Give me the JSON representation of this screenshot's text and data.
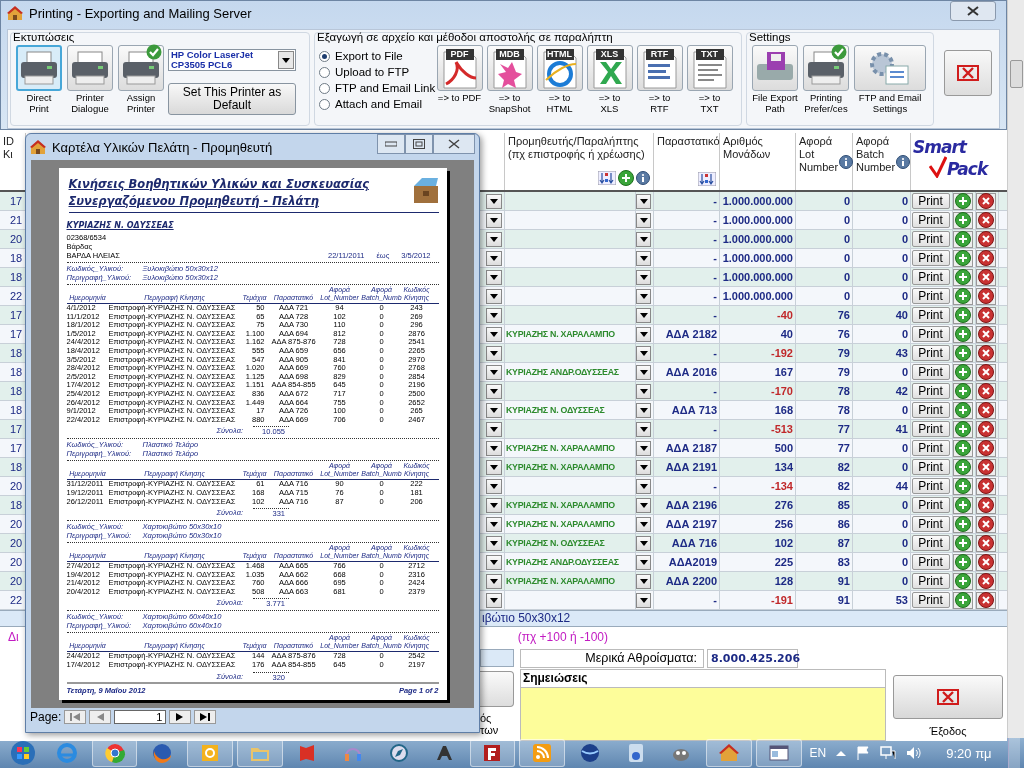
{
  "print_dialog": {
    "title": "Printing - Exporting and Mailing Server",
    "printing": {
      "title": "Εκτυπώσεις",
      "buttons": [
        {
          "label": "Direct\nPrint",
          "selected": true,
          "check": false
        },
        {
          "label": "Printer\nDialogue",
          "selected": false,
          "check": false
        },
        {
          "label": "Assign\nPrinter",
          "selected": false,
          "check": true
        }
      ],
      "printer": "HP Color LaserJet CP3505 PCL6",
      "set_default": "Set This Printer as Default"
    },
    "export": {
      "title": "Εξαγωγή σε αρχείο και μέθοδοι αποστολής σε παραλήπτη",
      "methods": [
        {
          "label": "Export to File",
          "selected": true
        },
        {
          "label": "Upload to FTP",
          "selected": false
        },
        {
          "label": "FTP and Email Link",
          "selected": false
        },
        {
          "label": "Attach and Email",
          "selected": false
        }
      ],
      "formats": [
        {
          "kind": "pdf",
          "icon_text": "PDF",
          "label": "=> to PDF"
        },
        {
          "kind": "mdb",
          "icon_text": "MDB",
          "label": "=> to\nSnapShot"
        },
        {
          "kind": "html",
          "icon_text": "HTML",
          "label": "=> to\nHTML"
        },
        {
          "kind": "xls",
          "icon_text": "XLS",
          "label": "=> to\nXLS"
        },
        {
          "kind": "rtf",
          "icon_text": "RTF",
          "label": "=> to\nRTF"
        },
        {
          "kind": "txt",
          "icon_text": "TXT",
          "label": "=> to\nTXT"
        }
      ]
    },
    "settings": {
      "title": "Settings",
      "buttons": [
        {
          "kind": "disk",
          "label": "File Export\nPath",
          "check": false
        },
        {
          "kind": "printer",
          "label": "Printing\nPrefer/ces",
          "check": true
        },
        {
          "kind": "gear",
          "label": "FTP and Email\nSettings",
          "check": false
        }
      ]
    }
  },
  "table": {
    "id_header": "ID\nΚι",
    "columns": [
      "Προμηθευτής/Παραλήπτης\n(πχ επιστροφής ή χρέωσης)",
      "Παραστατικό",
      "Αριθμός\nΜονάδων",
      "Αφορά\nLot\nNumber",
      "Αφορά\nBatch\nNumber"
    ],
    "logo": {
      "line_1": "Smart",
      "line_2": "Pack"
    },
    "rows": [
      {
        "id": "17",
        "document": "-",
        "units": "1.000.000.000",
        "kind": "stock",
        "lot": "0",
        "batch": "0",
        "print": "Print"
      },
      {
        "id": "21",
        "document": "-",
        "units": "1.000.000.000",
        "kind": "stock",
        "lot": "0",
        "batch": "0",
        "print": "Print"
      },
      {
        "id": "20",
        "document": "-",
        "units": "1.000.000.000",
        "kind": "stock",
        "lot": "0",
        "batch": "0",
        "print": "Print"
      },
      {
        "id": "18",
        "document": "-",
        "units": "1.000.000.000",
        "kind": "stock",
        "lot": "0",
        "batch": "0",
        "print": "Print"
      },
      {
        "id": "18",
        "document": "-",
        "units": "1.000.000.000",
        "kind": "stock",
        "lot": "0",
        "batch": "0",
        "print": "Print"
      },
      {
        "id": "22",
        "document": "-",
        "units": "1.000.000.000",
        "kind": "stock",
        "lot": "0",
        "batch": "0",
        "print": "Print"
      },
      {
        "id": "17",
        "document": "-",
        "units": "-40",
        "kind": "return",
        "lot": "76",
        "batch": "40",
        "print": "Print"
      },
      {
        "id": "17",
        "supplier": "ΚΥΡΙΑΖΗΣ Ν. ΧΑΡΑΛΑΜΠΟ",
        "document": "ΑΔΑ 2182",
        "units": "40",
        "kind": "stock",
        "lot": "76",
        "batch": "0",
        "print": "Print"
      },
      {
        "id": "18",
        "document": "-",
        "units": "-192",
        "kind": "return",
        "lot": "79",
        "batch": "43",
        "print": "Print"
      },
      {
        "id": "18",
        "supplier": "ΚΥΡΙΑΖΗΣ ΑΝΔΡ.ΟΔΥΣΣΕΑΣ",
        "document": "ΑΔΑ 2016",
        "units": "167",
        "kind": "stock",
        "lot": "79",
        "batch": "0",
        "print": "Print"
      },
      {
        "id": "18",
        "document": "-",
        "units": "-170",
        "kind": "return",
        "lot": "78",
        "batch": "42",
        "print": "Print"
      },
      {
        "id": "18",
        "supplier": "ΚΥΡΙΑΖΗΣ Ν. ΟΔΥΣΣΕΑΣ",
        "document": "ΑΔΑ 713",
        "units": "168",
        "kind": "stock",
        "lot": "78",
        "batch": "0",
        "print": "Print"
      },
      {
        "id": "17",
        "document": "-",
        "units": "-513",
        "kind": "return",
        "lot": "77",
        "batch": "41",
        "print": "Print"
      },
      {
        "id": "17",
        "supplier": "ΚΥΡΙΑΖΗΣ Ν. ΧΑΡΑΛΑΜΠΟ",
        "document": "ΑΔΑ 2187",
        "units": "500",
        "kind": "stock",
        "lot": "77",
        "batch": "0",
        "print": "Print"
      },
      {
        "id": "18",
        "supplier": "ΚΥΡΙΑΖΗΣ Ν. ΧΑΡΑΛΑΜΠΟ",
        "document": "ΑΔΑ 2191",
        "units": "134",
        "kind": "stock",
        "lot": "82",
        "batch": "0",
        "print": "Print"
      },
      {
        "id": "20",
        "document": "-",
        "units": "-134",
        "kind": "return",
        "lot": "82",
        "batch": "44",
        "print": "Print"
      },
      {
        "id": "18",
        "supplier": "ΚΥΡΙΑΖΗΣ Ν. ΧΑΡΑΛΑΜΠΟ",
        "document": "ΑΔΑ 2196",
        "units": "276",
        "kind": "stock",
        "lot": "85",
        "batch": "0",
        "print": "Print"
      },
      {
        "id": "20",
        "supplier": "ΚΥΡΙΑΖΗΣ Ν. ΧΑΡΑΛΑΜΠΟ",
        "document": "ΑΔΑ 2197",
        "units": "256",
        "kind": "stock",
        "lot": "86",
        "batch": "0",
        "print": "Print"
      },
      {
        "id": "20",
        "supplier": "ΚΥΡΙΑΖΗΣ Ν. ΟΔΥΣΣΕΑΣ",
        "document": "ΑΔΑ 716",
        "units": "102",
        "kind": "stock",
        "lot": "87",
        "batch": "0",
        "print": "Print"
      },
      {
        "id": "20",
        "supplier": "ΚΥΡΙΑΖΗΣ ΑΝΔΡ.ΟΔΥΣΣΕΑΣ",
        "document": "ΑΔΑ2019",
        "units": "225",
        "kind": "stock",
        "lot": "83",
        "batch": "0",
        "print": "Print"
      },
      {
        "id": "20",
        "supplier": "ΚΥΡΙΑΖΗΣ Ν. ΧΑΡΑΛΑΜΠΟ",
        "document": "ΑΔΑ 2200",
        "units": "128",
        "kind": "stock",
        "lot": "91",
        "batch": "0",
        "print": "Print"
      },
      {
        "id": "22",
        "document": "-",
        "units": "-191",
        "kind": "return",
        "lot": "91",
        "batch": "53",
        "print": "Print"
      }
    ]
  },
  "bottom": {
    "material_bar": "ιβώτιο 50x30x12",
    "hint_left": "Δι",
    "hint": "(πχ +100 ή -100)",
    "partial_label": "ός\nτων",
    "subtotal_label": "Μερικά Αθροίσματα:",
    "subtotal_value": "8.000.425.206",
    "notes_label": "Σημειώσεις",
    "exit_label": "Έξοδος"
  },
  "preview": {
    "title": "Καρτέλα Υλικών Πελάτη - Προμηθευτή",
    "report": {
      "title": "Κινήσεις Βοηθητικών Υλικών και Συσκευασίας\nΣυνεργαζόμενου Προμηθευτή - Πελάτη",
      "customer": "ΚΥΡΙΑΖΗΣ Ν. ΟΔΥΣΣΕΑΣ",
      "address": [
        "02368/6534",
        "Βάρδας",
        "ΒΑΡΔΑ ΗΛΕΙΑΣ"
      ],
      "date_from": "22/11/2011",
      "date_sep": "έως",
      "date_to": "3/5/2012",
      "groups": [
        {
          "code_label": "Κωδικός_Υλικού:",
          "desc_label": "Περιγραφή_Υλικού:",
          "total_label": "Σύνολα:",
          "columns": [
            "Ημερομηνία",
            "Περιγραφή Κίνησης",
            "Τεμάχια",
            "Παραστατικό",
            "Αφορά\nLot_Number",
            "Αφορά\nBatch_Numb",
            "Κωδικός\nΚίνησης"
          ],
          "code": "Ξυλοκιβώτιο 50x30x12",
          "desc": "Ξυλοκιβώτιο 50x30x12",
          "total": "10.055",
          "rows": [
            [
              "4/1/2012",
              "Επιστροφή-ΚΥΡΙΑΖΗΣ Ν. ΟΔΥΣΣΕΑΣ",
              "50",
              "ΑΔΑ 721",
              "94",
              "0",
              "243"
            ],
            [
              "11/1/2012",
              "Επιστροφή-ΚΥΡΙΑΖΗΣ Ν. ΟΔΥΣΣΕΑΣ",
              "65",
              "ΑΔΑ 728",
              "102",
              "0",
              "269"
            ],
            [
              "18/1/2012",
              "Επιστροφή-ΚΥΡΙΑΖΗΣ Ν. ΟΔΥΣΣΕΑΣ",
              "75",
              "ΑΔΑ 730",
              "110",
              "0",
              "296"
            ],
            [
              "1/5/2012",
              "Επιστροφή-ΚΥΡΙΑΖΗΣ Ν. ΟΔΥΣΣΕΑΣ",
              "1.100",
              "ΑΔΑ 694",
              "812",
              "0",
              "2876"
            ],
            [
              "24/4/2012",
              "Επιστροφή-ΚΥΡΙΑΖΗΣ Ν. ΟΔΥΣΣΕΑΣ",
              "1.162",
              "ΑΔΑ 875-876",
              "728",
              "0",
              "2541"
            ],
            [
              "18/4/2012",
              "Επιστροφή-ΚΥΡΙΑΖΗΣ Ν. ΟΔΥΣΣΕΑΣ",
              "555",
              "ΑΔΑ 659",
              "656",
              "0",
              "2265"
            ],
            [
              "3/5/2012",
              "Επιστροφή-ΚΥΡΙΑΖΗΣ Ν. ΟΔΥΣΣΕΑΣ",
              "547",
              "ΑΔΑ 905",
              "841",
              "0",
              "2970"
            ],
            [
              "28/4/2012",
              "Επιστροφή-ΚΥΡΙΑΖΗΣ Ν. ΟΔΥΣΣΕΑΣ",
              "1.020",
              "ΑΔΑ 669",
              "760",
              "0",
              "2768"
            ],
            [
              "2/5/2012",
              "Επιστροφή-ΚΥΡΙΑΖΗΣ Ν. ΟΔΥΣΣΕΑΣ",
              "1.125",
              "ΑΔΑ 698",
              "829",
              "0",
              "2854"
            ],
            [
              "17/4/2012",
              "Επιστροφή-ΚΥΡΙΑΖΗΣ Ν. ΟΔΥΣΣΕΑΣ",
              "1.151",
              "ΑΔΑ 854-855",
              "645",
              "0",
              "2196"
            ],
            [
              "25/4/2012",
              "Επιστροφή-ΚΥΡΙΑΖΗΣ Ν. ΟΔΥΣΣΕΑΣ",
              "836",
              "ΑΔΑ 672",
              "717",
              "0",
              "2500"
            ],
            [
              "26/4/2012",
              "Επιστροφή-ΚΥΡΙΑΖΗΣ Ν. ΟΔΥΣΣΕΑΣ",
              "1.449",
              "ΑΔΑ 664",
              "755",
              "0",
              "2652"
            ],
            [
              "9/1/2012",
              "Επιστροφή-ΚΥΡΙΑΖΗΣ Ν. ΟΔΥΣΣΕΑΣ",
              "17",
              "ΑΔΑ 726",
              "100",
              "0",
              "265"
            ],
            [
              "22/4/2012",
              "Επιστροφή-ΚΥΡΙΑΖΗΣ Ν. ΟΔΥΣΣΕΑΣ",
              "880",
              "ΑΔΑ 669",
              "706",
              "0",
              "2467"
            ]
          ]
        },
        {
          "code_label": "Κωδικός_Υλικού:",
          "desc_label": "Περιγραφή_Υλικού:",
          "total_label": "Σύνολα:",
          "columns": [
            "Ημερομηνία",
            "Περιγραφή Κίνησης",
            "Τεμάχια",
            "Παραστατικό",
            "Αφορά\nLot_Number",
            "Αφορά\nBatch_Numb",
            "Κωδικός\nΚίνησης"
          ],
          "code": "Πλαστικό Τελάρο",
          "desc": "Πλαστικό Τελάρο",
          "total": "331",
          "rows": [
            [
              "31/12/2011",
              "Επιστροφή-ΚΥΡΙΑΖΗΣ Ν. ΟΔΥΣΣΕΑΣ",
              "61",
              "ΑΔΑ 716",
              "90",
              "0",
              "222"
            ],
            [
              "19/12/2011",
              "Επιστροφή-ΚΥΡΙΑΖΗΣ Ν. ΟΔΥΣΣΕΑΣ",
              "168",
              "ΑΔΑ 715",
              "76",
              "0",
              "181"
            ],
            [
              "26/12/2011",
              "Επιστροφή-ΚΥΡΙΑΖΗΣ Ν. ΟΔΥΣΣΕΑΣ",
              "102",
              "ΑΔΑ 716",
              "87",
              "0",
              "206"
            ]
          ]
        },
        {
          "code_label": "Κωδικός_Υλικού:",
          "desc_label": "Περιγραφή_Υλικού:",
          "total_label": "Σύνολα:",
          "columns": [
            "Ημερομηνία",
            "Περιγραφή Κίνησης",
            "Τεμάχια",
            "Παραστατικό",
            "Αφορά\nLot_Number",
            "Αφορά\nBatch_Numb",
            "Κωδικός\nΚίνησης"
          ],
          "code": "Χαρτοκιβώτιο 50x30x10",
          "desc": "Χαρτοκιβώτιο 50x30x10",
          "total": "3.771",
          "rows": [
            [
              "27/4/2012",
              "Επιστροφή-ΚΥΡΙΑΖΗΣ Ν. ΟΔΥΣΣΕΑΣ",
              "1.468",
              "ΑΔΑ 665",
              "766",
              "0",
              "2712"
            ],
            [
              "19/4/2012",
              "Επιστροφή-ΚΥΡΙΑΖΗΣ Ν. ΟΔΥΣΣΕΑΣ",
              "1.035",
              "ΑΔΑ 662",
              "668",
              "0",
              "2316"
            ],
            [
              "21/4/2012",
              "Επιστροφή-ΚΥΡΙΑΖΗΣ Ν. ΟΔΥΣΣΕΑΣ",
              "760",
              "ΑΔΑ 666",
              "695",
              "0",
              "2424"
            ],
            [
              "20/4/2012",
              "Επιστροφή-ΚΥΡΙΑΖΗΣ Ν. ΟΔΥΣΣΕΑΣ",
              "508",
              "ΑΔΑ 663",
              "681",
              "0",
              "2379"
            ]
          ]
        },
        {
          "code_label": "Κωδικός_Υλικού:",
          "desc_label": "Περιγραφή_Υλικού:",
          "total_label": "Σύνολα:",
          "columns": [
            "Ημερομηνία",
            "Περιγραφή Κίνησης",
            "Τεμάχια",
            "Παραστατικό",
            "Αφορά\nLot_Number",
            "Αφορά\nBatch_Numb",
            "Κωδικός\nΚίνησης"
          ],
          "code": "Χαρτοκιβώτιο 60x40x10",
          "desc": "Χαρτοκιβώτιο 60x40x10",
          "total": "320",
          "rows": [
            [
              "24/4/2012",
              "Επιστροφή-ΚΥΡΙΑΖΗΣ Ν. ΟΔΥΣΣΕΑΣ",
              "144",
              "ΑΔΑ 875-876",
              "728",
              "0",
              "2542"
            ],
            [
              "17/4/2012",
              "Επιστροφή-ΚΥΡΙΑΖΗΣ Ν. ΟΔΥΣΣΕΑΣ",
              "176",
              "ΑΔΑ 854-855",
              "645",
              "0",
              "2197"
            ]
          ]
        }
      ],
      "footer_date": "Τετάρτη, 9 Μαΐου 2012",
      "footer_page": "Page 1 of 2"
    },
    "page_label": "Page:",
    "page_number": "1"
  },
  "taskbar": {
    "language": "EN",
    "clock": "9:20 πμ"
  }
}
